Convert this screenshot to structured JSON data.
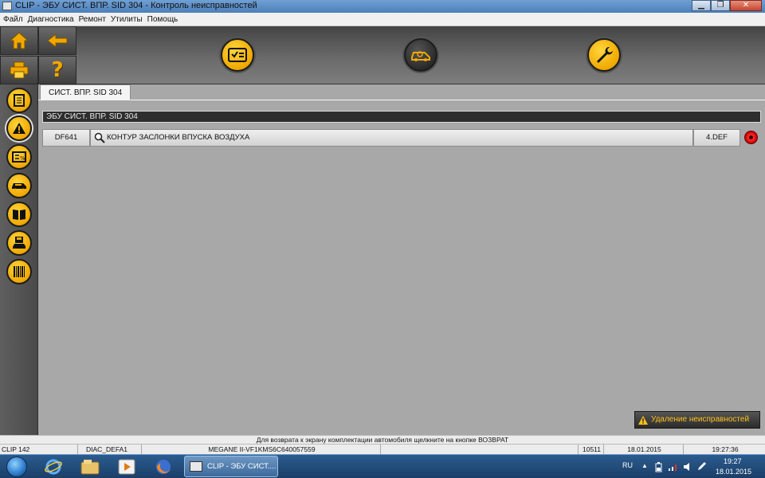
{
  "window": {
    "title": "CLIP - ЭБУ СИСТ. ВПР. SID 304 - Контроль неисправностей",
    "min_label": "▁",
    "max_label": "❐",
    "close_label": "✕"
  },
  "menu": [
    "Файл",
    "Диагностика",
    "Ремонт",
    "Утилиты",
    "Помощь"
  ],
  "toolbar": {
    "icons": [
      "home-icon",
      "back-arrow-icon",
      "printer-icon",
      "help-icon",
      "checklist-icon",
      "vehicle-scan-icon",
      "wrench-icon"
    ],
    "help_label": "?"
  },
  "sidebar": {
    "icons": [
      "document-icon",
      "warning-icon",
      "parameters-icon",
      "vehicle-icon",
      "book-icon",
      "vehicle-save-icon",
      "barcode-icon"
    ]
  },
  "tab": {
    "label": "СИСТ. ВПР. SID 304"
  },
  "ecu_header": "ЭБУ СИСТ. ВПР. SID 304",
  "fault": {
    "code": "DF641",
    "description": "КОНТУР ЗАСЛОНКИ ВПУСКА ВОЗДУХА",
    "status": "4.DEF",
    "indicator_color": "#e00000"
  },
  "clear_faults_label": "Удаление неисправностей",
  "hint": "Для возврата к экрану комплектации автомобиля щелкните на кнопке ВОЗВРАТ",
  "status_bar": {
    "clip": "CLIP 142",
    "diag": "DIAC_DEFA1",
    "vehicle": "MEGANE II-VF1KMS6C640057559",
    "number": "10511",
    "date": "18.01.2015",
    "time": "19:27:36"
  },
  "taskbar": {
    "task_label": "CLIP - ЭБУ СИСТ....",
    "lang": "RU",
    "clock_time": "19:27",
    "clock_date": "18.01.2015"
  },
  "colors": {
    "accent": "#f0a800",
    "panel": "#a8a8a8",
    "toolbar": "#5a5a5a"
  }
}
